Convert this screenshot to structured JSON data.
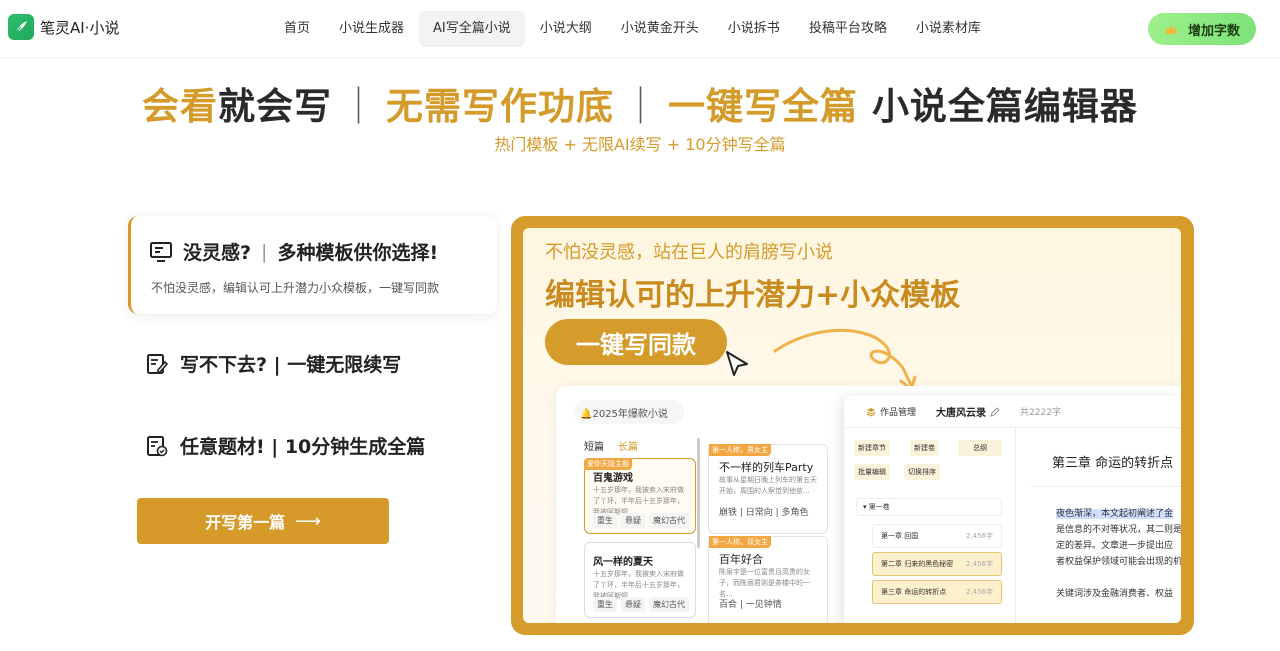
{
  "header": {
    "brand": "笔灵AI·小说",
    "menu": [
      "首页",
      "小说生成器",
      "AI写全篇小说",
      "小说大纲",
      "小说黄金开头",
      "小说拆书",
      "投稿平台攻略",
      "小说素材库"
    ],
    "active_index": 2,
    "add_words": "增加字数"
  },
  "hero": {
    "p1a": "会看",
    "p1b": "就会写",
    "p2": "无需写作功底",
    "p3": "一键写全篇",
    "p4": "小说全篇编辑器",
    "sep": "｜",
    "subtitle": "热门模板 + 无限AI续写 + 10分钟写全篇"
  },
  "features": {
    "card": {
      "title_a": "没灵感?",
      "title_b": "多种模板供你选择!",
      "desc": "不怕没灵感，编辑认可上升潜力小众模板，一键写同款"
    },
    "row2": "写不下去? | 一键无限续写",
    "row3": "任意题材! | 10分钟生成全篇",
    "start": "开写第一篇",
    "start_arrow": "⟶"
  },
  "showcase": {
    "subtitle": "不怕没灵感，站在巨人的肩膀写小说",
    "title": "编辑认可的上升潜力+小众模板",
    "cta": "一键写同款",
    "tag": "🔔2025年爆款小说",
    "tabs": [
      "短篇",
      "长篇"
    ],
    "novels": [
      {
        "badge": "爱你天隐主题",
        "title": "百鬼游戏",
        "desc": "十五岁那年，我被卖入宋府做了丫环，半年后十五岁那年，我被阿斯顿",
        "tags": [
          "重生",
          "悬疑",
          "魔幻古代"
        ]
      },
      {
        "badge": "",
        "title": "风一样的夏天",
        "desc": "十五岁那年，我被卖入宋府做了丫环，半年后十五岁那年，我被阿斯顿",
        "tags": [
          "重生",
          "悬疑",
          "魔幻古代"
        ]
      }
    ],
    "novels2": [
      {
        "badge": "第一人称，男女主",
        "title": "不一样的列车Party",
        "desc": "故事从星期日晚上列车的第五天开始，周围的人察觉到他依...",
        "meta": "崩铁 | 日常向 | 多角色"
      },
      {
        "badge": "第一人称，双女主",
        "title": "百年好合",
        "desc": "陈泉宇是一位富贵且高贵的女子，而陈丽君则是茶楼中的一名...",
        "meta": "百合 | 一见钟情"
      }
    ],
    "editor": {
      "manage": "作品管理",
      "book": "大唐风云录",
      "count": "共2222字",
      "actions": [
        "新建章节",
        "新建卷",
        "总纲",
        "批量编辑",
        "切换排序"
      ],
      "volume": "第一卷",
      "chapters": [
        {
          "name": "第一章 回国",
          "words": "2,456字"
        },
        {
          "name": "第二章 归来的黑色秘密",
          "words": "2,456字"
        },
        {
          "name": "第三章 命运的转折点",
          "words": "2,456字"
        }
      ],
      "chapter_title": "第三章 命运的转折点",
      "text_mark": "夜色渐深，本文起初阐述了金",
      "text_lines": [
        "是信息的不对等状况，其二则是",
        "定的差异。文章进一步提出应",
        "者权益保护领域可能会出现的机"
      ],
      "text2": "关键词涉及金融消费者、权益"
    }
  }
}
